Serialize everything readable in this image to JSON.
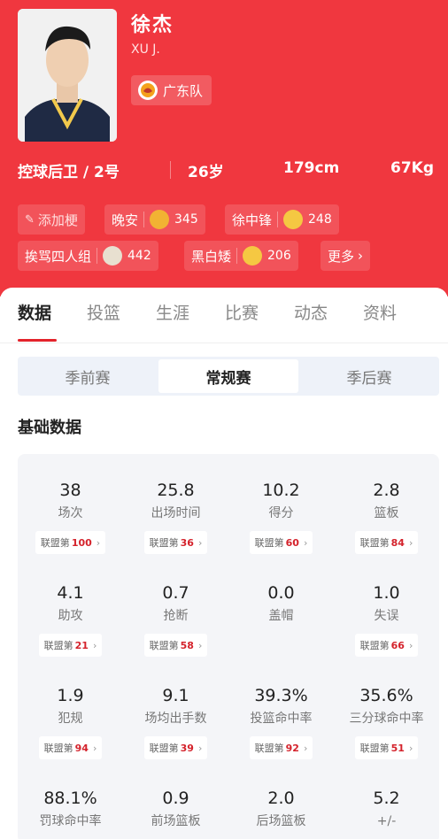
{
  "player": {
    "name": "徐杰",
    "english_name": "XU J.",
    "team": "广东队",
    "position": "控球后卫 / 2号",
    "age": "26岁",
    "height": "179cm",
    "weight": "67Kg"
  },
  "tags": {
    "add_label": "添加梗",
    "items": [
      {
        "label": "晚安",
        "count": "345",
        "emoji_color": "#f2b233"
      },
      {
        "label": "徐中锋",
        "count": "248",
        "emoji_color": "#f5c842"
      },
      {
        "label": "挨骂四人组",
        "count": "442",
        "emoji_color": "#e8e0d0"
      },
      {
        "label": "黑白矮",
        "count": "206",
        "emoji_color": "#f5c842"
      }
    ],
    "more_label": "更多"
  },
  "tabs": [
    "数据",
    "投篮",
    "生涯",
    "比赛",
    "动态",
    "资料"
  ],
  "segments": [
    "季前赛",
    "常规赛",
    "季后赛"
  ],
  "section_title": "基础数据",
  "rank_prefix": "联盟第",
  "stats": [
    {
      "value": "38",
      "label": "场次",
      "rank": "100"
    },
    {
      "value": "25.8",
      "label": "出场时间",
      "rank": "36"
    },
    {
      "value": "10.2",
      "label": "得分",
      "rank": "60"
    },
    {
      "value": "2.8",
      "label": "篮板",
      "rank": "84"
    },
    {
      "value": "4.1",
      "label": "助攻",
      "rank": "21"
    },
    {
      "value": "0.7",
      "label": "抢断",
      "rank": "58"
    },
    {
      "value": "0.0",
      "label": "盖帽",
      "rank": null
    },
    {
      "value": "1.0",
      "label": "失误",
      "rank": "66"
    },
    {
      "value": "1.9",
      "label": "犯规",
      "rank": "94"
    },
    {
      "value": "9.1",
      "label": "场均出手数",
      "rank": "39"
    },
    {
      "value": "39.3%",
      "label": "投篮命中率",
      "rank": "92"
    },
    {
      "value": "35.6%",
      "label": "三分球命中率",
      "rank": "51"
    },
    {
      "value": "88.1%",
      "label": "罚球命中率",
      "rank": null
    },
    {
      "value": "0.9",
      "label": "前场篮板",
      "rank": null
    },
    {
      "value": "2.0",
      "label": "后场篮板",
      "rank": null
    },
    {
      "value": "5.2",
      "label": "+/-",
      "rank": null
    }
  ],
  "colors": {
    "header": "#f0373f",
    "accent": "#e3232b"
  }
}
